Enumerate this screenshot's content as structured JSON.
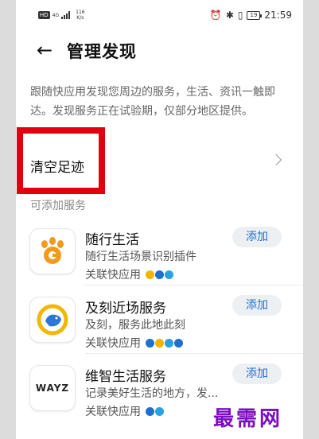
{
  "statusbar": {
    "hd": "HD",
    "net": "4G",
    "speed_value": "116",
    "speed_unit": "K/s",
    "battery": "19",
    "time": "21:59"
  },
  "header": {
    "title": "管理发现"
  },
  "description": "跟随快应用发现您周边的服务，生活、资讯一触即达。发现服务正在试验期，仅部分地区提供。",
  "clear_history": {
    "label": "清空足迹"
  },
  "section_title": "可添加服务",
  "services": [
    {
      "title": "随行生活",
      "subtitle": "随行生活场景识别插件",
      "related": "关联快应用",
      "button": "添加",
      "icon": "paw-icon",
      "mini_colors": [
        "#f5b400",
        "#1f6fd1",
        "#2aa0e0"
      ]
    },
    {
      "title": "及刻近场服务",
      "subtitle": "及刻，服务此地此刻",
      "related": "关联快应用",
      "button": "添加",
      "icon": "bird-icon",
      "mini_colors": [
        "#1f6fd1",
        "#f5b400",
        "#2aa0e0",
        "#1f6fd1"
      ]
    },
    {
      "title": "维智生活服务",
      "subtitle": "记录美好生活的地方，发...",
      "related": "关联快应用",
      "button": "添加",
      "icon": "wayz-logo",
      "logo_text": "WAYZ",
      "mini_colors": [
        "#1f6fd1",
        "#2aa0e0"
      ]
    }
  ],
  "watermark": "最需网",
  "colors": {
    "accent": "#1f6fd1",
    "highlight": "#e1000f",
    "paw": "#f29a1c",
    "bird_ring": "#f2b705",
    "bird_body": "#2a78d6"
  }
}
